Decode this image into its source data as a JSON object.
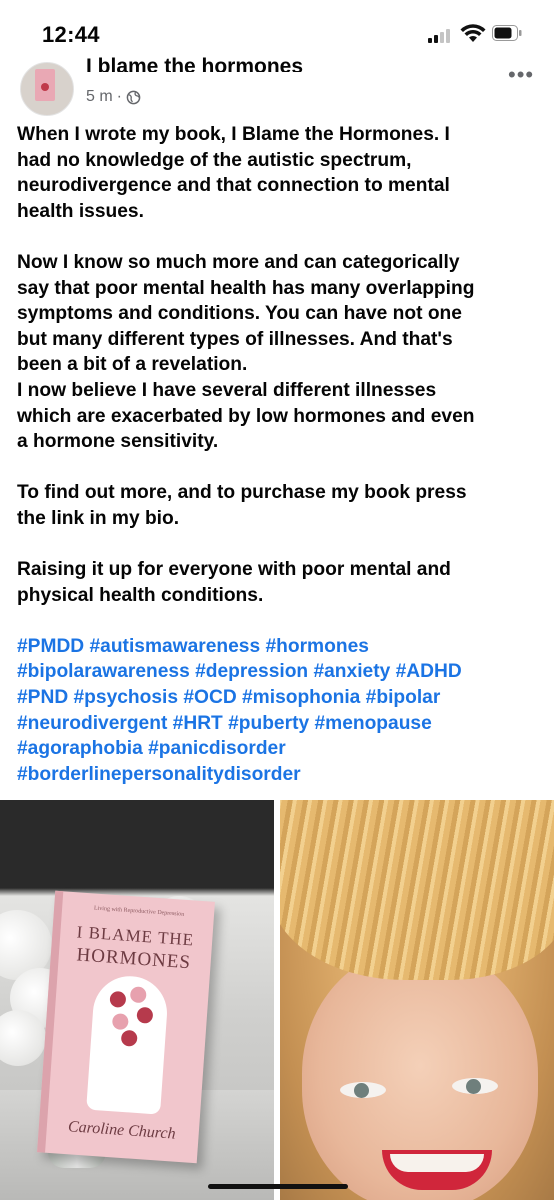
{
  "status_bar": {
    "time": "12:44",
    "icons": [
      "cellular-signal-icon",
      "wifi-icon",
      "battery-icon"
    ]
  },
  "post": {
    "author": "I blame the hormones",
    "time_ago": "5 m",
    "separator": "·",
    "audience_icon": "globe-icon",
    "more_label": "•••",
    "paragraphs": [
      [
        "When I wrote my book, I Blame the Hormones. I",
        "had no knowledge of the autistic spectrum,",
        "neurodivergence and that connection to mental",
        "health issues."
      ],
      [
        "Now I know so much more and can categorically",
        "say that poor mental health has many overlapping",
        "symptoms and conditions. You can have not one",
        "but many different types of illnesses. And that's",
        "been a bit of a revelation.",
        "I now believe I have several different illnesses",
        "which are exacerbated by low hormones and even",
        "a hormone sensitivity."
      ],
      [
        "To find out more, and to purchase my book press",
        "the link in my bio."
      ],
      [
        "Raising it up for everyone with poor mental and",
        "physical health conditions."
      ]
    ],
    "hashtag_lines": [
      "#PMDD #autismawareness #hormones",
      "#bipolarawareness #depression #anxiety #ADHD",
      "#PND #psychosis #OCD #misophonia #bipolar",
      "#neurodivergent #HRT #puberty #menopause",
      "#agoraphobia #panicdisorder",
      "#borderlinepersonalitydisorder"
    ],
    "photos": {
      "book": {
        "tagline": "Living with Reproductive Depression",
        "title_line1": "I BLAME THE",
        "title_line2": "HORMONES",
        "author": "Caroline Church"
      }
    }
  },
  "colors": {
    "hashtag": "#1b74e4",
    "meta_text": "#65676b",
    "text": "#050505"
  }
}
